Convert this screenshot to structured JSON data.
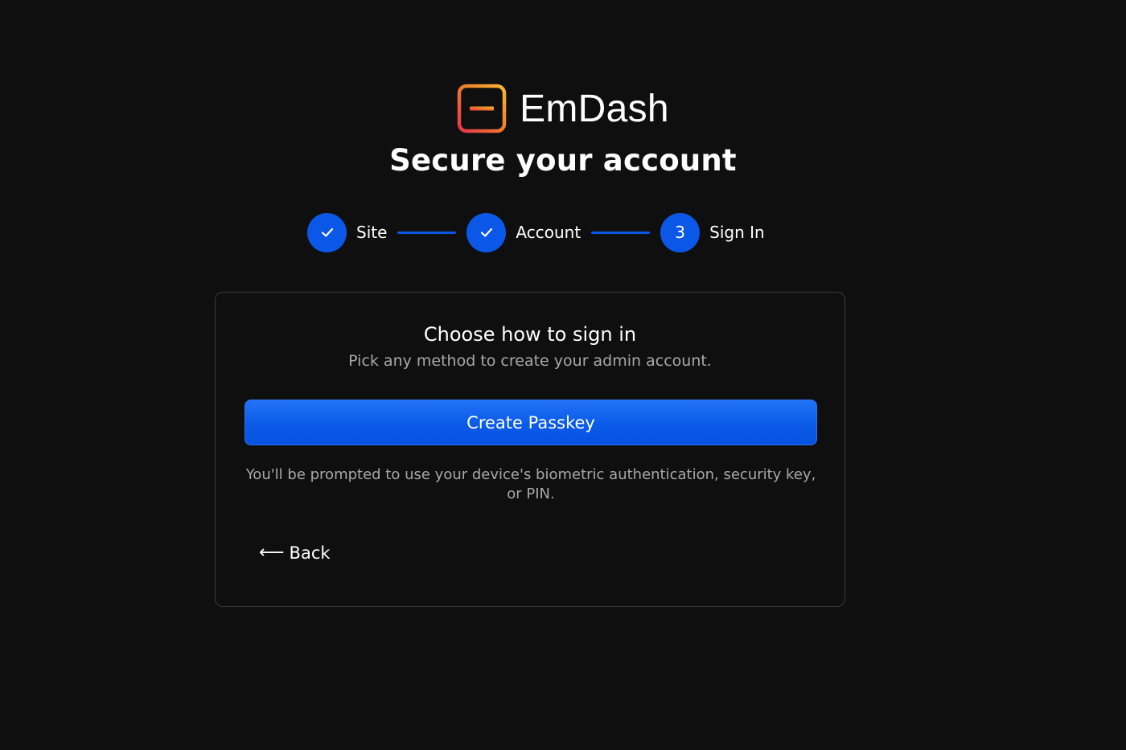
{
  "brand": {
    "name": "EmDash",
    "logo_icon": "emdash-logo-icon",
    "logo_gradient": [
      "#f5a623",
      "#e8344e"
    ]
  },
  "page": {
    "title": "Secure your account"
  },
  "stepper": {
    "accent_color": "#0b57e8",
    "steps": [
      {
        "label": "Site",
        "status": "complete",
        "icon": "check-icon"
      },
      {
        "label": "Account",
        "status": "complete",
        "icon": "check-icon"
      },
      {
        "label": "Sign In",
        "status": "current",
        "number": "3"
      }
    ]
  },
  "card": {
    "title": "Choose how to sign in",
    "subtitle": "Pick any method to create your admin account.",
    "primary_button": "Create Passkey",
    "hint": "You'll be prompted to use your device's biometric authentication, security key, or PIN.",
    "back_arrow": "⟵",
    "back_label": "Back"
  }
}
